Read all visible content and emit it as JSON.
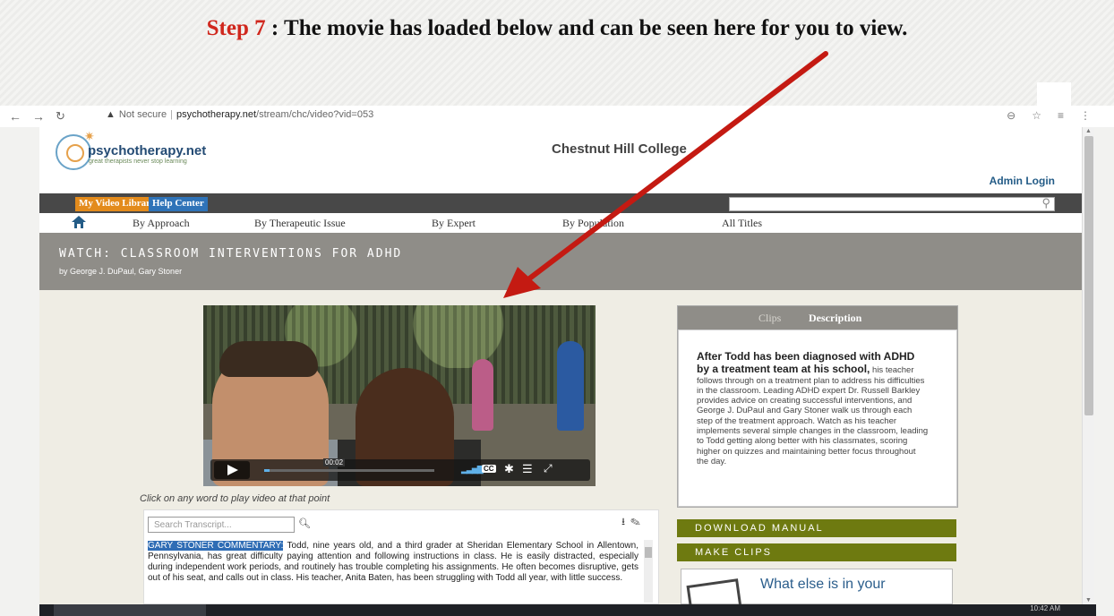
{
  "banner": {
    "step": "Step 7",
    "text": " : The movie has loaded below and can be seen here for you to view."
  },
  "browser": {
    "security": "Not secure",
    "url_host": "psychotherapy.net",
    "url_path": "/stream/chc/video?vid=053"
  },
  "site": {
    "logo_name": "psychotherapy.net",
    "tagline": "great therapists never stop learning",
    "college": "Chestnut Hill College",
    "admin_login": "Admin Login"
  },
  "menubar": {
    "video_library": "My Video Library",
    "help_center": "Help Center"
  },
  "catnav": {
    "items": [
      "By Approach",
      "By Therapeutic Issue",
      "By Expert",
      "By Population",
      "All Titles"
    ]
  },
  "watch": {
    "title": "WATCH: CLASSROOM INTERVENTIONS FOR ADHD",
    "by": "by George J. DuPaul, Gary Stoner"
  },
  "video": {
    "time": "00:02",
    "cc": "CC",
    "played_fraction": 0.03
  },
  "transcript": {
    "hint": "Click on any word to play video at that point",
    "search_placeholder": "Search Transcript...",
    "speaker": "GARY STONER COMMENTARY:",
    "text": " Todd, nine years old, and a third grader at Sheridan Elementary School in Allentown, Pennsylvania, has great difficulty paying attention and following instructions in class. He is easily distracted, especially during independent work periods, and routinely has trouble completing his assignments. He often becomes disruptive, gets out of his seat, and calls out in class. His teacher, Anita Baten, has been struggling with Todd all year, with little success."
  },
  "description": {
    "tab_clips": "Clips",
    "tab_description": "Description",
    "lead": "After Todd has been diagnosed with ADHD by a treatment team at his school,",
    "body": " his teacher follows through on a treatment plan to address his difficulties in the classroom. Leading ADHD expert Dr. Russell Barkley provides advice on creating successful interventions, and George J. DuPaul and Gary Stoner walk us through each step of the treatment approach. Watch as his teacher implements several simple changes in the classroom, leading to Todd getting along better with his classmates, scoring higher on quizzes and maintaining better focus throughout the day."
  },
  "actions": {
    "download_manual": "DOWNLOAD MANUAL",
    "make_clips": "MAKE CLIPS",
    "what_else": "What else is in your"
  },
  "taskbar": {
    "clock": "10:42 AM"
  },
  "colors": {
    "step_red": "#d0271d",
    "arrow_red": "#c41a12",
    "library_orange": "#e38b1c",
    "help_blue": "#2f73b8",
    "green_button": "#6e7a10"
  }
}
